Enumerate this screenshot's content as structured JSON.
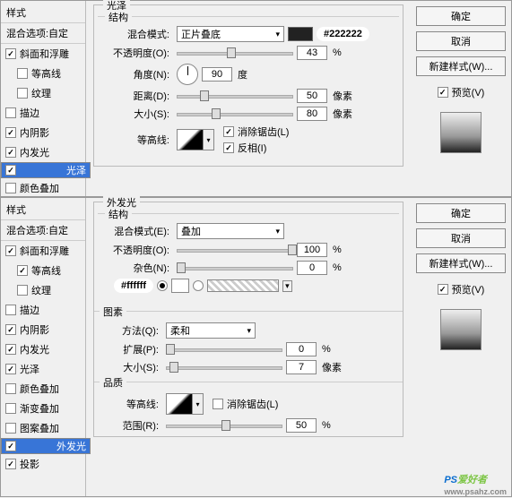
{
  "top": {
    "sidebar": {
      "head": "样式",
      "blend": "混合选项:自定",
      "items": [
        {
          "label": "斜面和浮雕",
          "on": true,
          "indent": false
        },
        {
          "label": "等高线",
          "on": false,
          "indent": true
        },
        {
          "label": "纹理",
          "on": false,
          "indent": true
        },
        {
          "label": "描边",
          "on": false,
          "indent": false
        },
        {
          "label": "内阴影",
          "on": true,
          "indent": false
        },
        {
          "label": "内发光",
          "on": true,
          "indent": false
        },
        {
          "label": "光泽",
          "on": true,
          "indent": false,
          "sel": true
        },
        {
          "label": "颜色叠加",
          "on": false,
          "indent": false
        }
      ]
    },
    "panel": {
      "title": "光泽",
      "struct": "结构",
      "blend_lbl": "混合模式:",
      "blend_val": "正片叠底",
      "color_tag": "#222222",
      "opacity_lbl": "不透明度(O):",
      "opacity_val": "43",
      "pct": "%",
      "angle_lbl": "角度(N):",
      "angle_val": "90",
      "deg": "度",
      "dist_lbl": "距离(D):",
      "dist_val": "50",
      "px": "像素",
      "size_lbl": "大小(S):",
      "size_val": "80",
      "contour_lbl": "等高线:",
      "anti": "消除锯齿(L)",
      "invert": "反相(I)"
    },
    "right": {
      "ok": "确定",
      "cancel": "取消",
      "new": "新建样式(W)...",
      "preview": "预览(V)"
    }
  },
  "bottom": {
    "sidebar": {
      "head": "样式",
      "blend": "混合选项:自定",
      "items": [
        {
          "label": "斜面和浮雕",
          "on": true,
          "indent": false
        },
        {
          "label": "等高线",
          "on": true,
          "indent": true
        },
        {
          "label": "纹理",
          "on": false,
          "indent": true
        },
        {
          "label": "描边",
          "on": false,
          "indent": false
        },
        {
          "label": "内阴影",
          "on": true,
          "indent": false
        },
        {
          "label": "内发光",
          "on": true,
          "indent": false
        },
        {
          "label": "光泽",
          "on": true,
          "indent": false
        },
        {
          "label": "颜色叠加",
          "on": false,
          "indent": false
        },
        {
          "label": "渐变叠加",
          "on": false,
          "indent": false
        },
        {
          "label": "图案叠加",
          "on": false,
          "indent": false
        },
        {
          "label": "外发光",
          "on": true,
          "indent": false,
          "sel": true
        },
        {
          "label": "投影",
          "on": true,
          "indent": false
        }
      ]
    },
    "panel": {
      "title": "外发光",
      "struct": "结构",
      "blend_lbl": "混合模式(E):",
      "blend_val": "叠加",
      "opacity_lbl": "不透明度(O):",
      "opacity_val": "100",
      "pct": "%",
      "noise_lbl": "杂色(N):",
      "noise_val": "0",
      "color_tag": "#ffffff",
      "elements": "图素",
      "technique_lbl": "方法(Q):",
      "technique_val": "柔和",
      "spread_lbl": "扩展(P):",
      "spread_val": "0",
      "size_lbl": "大小(S):",
      "size_val": "7",
      "px": "像素",
      "quality": "品质",
      "contour_lbl": "等高线:",
      "anti": "消除锯齿(L)",
      "range_lbl": "范围(R):",
      "range_val": "50"
    },
    "right": {
      "ok": "确定",
      "cancel": "取消",
      "new": "新建样式(W)...",
      "preview": "预览(V)"
    }
  },
  "watermark": {
    "big": "PS",
    "txt": "爱好者",
    "sub": "www.psahz.com"
  }
}
